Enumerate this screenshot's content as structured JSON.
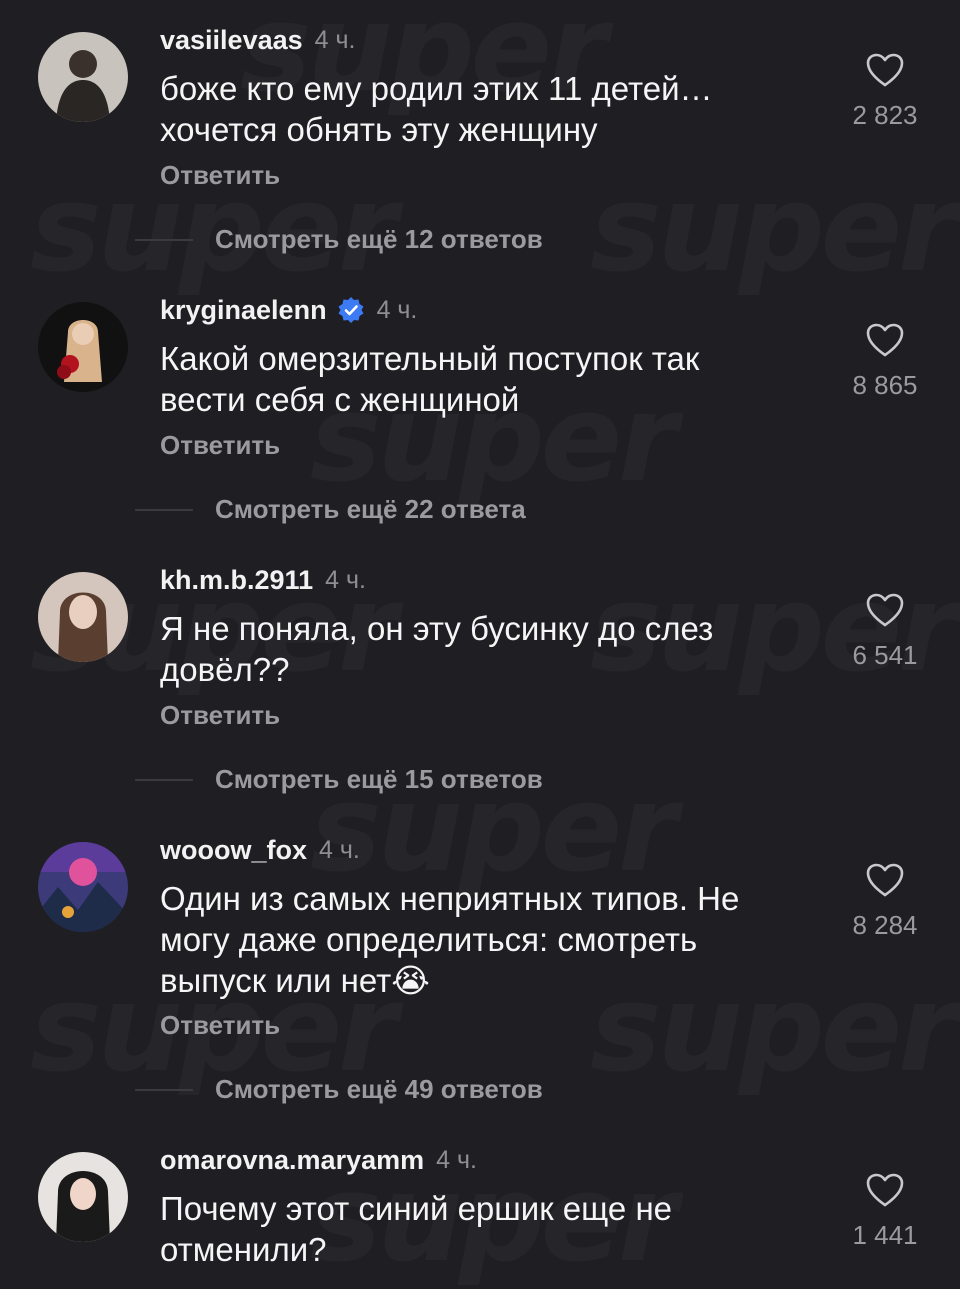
{
  "watermark": "super",
  "comments": [
    {
      "username": "vasiilevaas",
      "verified": false,
      "time": "4 ч.",
      "text_lines": [
        "боже кто ему родил этих 11 детей…",
        "хочется обнять эту женщину"
      ],
      "reply_label": "Ответить",
      "likes": "2 823",
      "more_replies": "Смотреть ещё 12 ответов",
      "avatar_colors": [
        "#c8c3bd",
        "#2a2624"
      ]
    },
    {
      "username": "kryginaelenn",
      "verified": true,
      "time": "4 ч.",
      "text_lines": [
        "Какой омерзительный поступок так",
        "вести себя с женщиной"
      ],
      "reply_label": "Ответить",
      "likes": "8 865",
      "more_replies": "Смотреть ещё 22 ответа",
      "avatar_colors": [
        "#111111",
        "#d9b38c"
      ]
    },
    {
      "username": "kh.m.b.2911",
      "verified": false,
      "time": "4 ч.",
      "text_lines": [
        "Я не поняла, он эту бусинку до слез",
        "довёл??"
      ],
      "reply_label": "Ответить",
      "likes": "6 541",
      "more_replies": "Смотреть ещё 15 ответов",
      "avatar_colors": [
        "#d4c6bd",
        "#5a3f30"
      ]
    },
    {
      "username": "wooow_fox",
      "verified": false,
      "time": "4 ч.",
      "text_lines": [
        "Один из самых неприятных типов. Не",
        "могу даже определиться: смотреть",
        "выпуск или нет😭"
      ],
      "reply_label": "Ответить",
      "likes": "8 284",
      "more_replies": "Смотреть ещё 49 ответов",
      "avatar_colors": [
        "#3d3a7a",
        "#e0529c"
      ]
    },
    {
      "username": "omarovna.maryamm",
      "verified": false,
      "time": "4 ч.",
      "text_lines": [
        "Почему этот синий ершик еще не",
        "отменили?"
      ],
      "reply_label": "",
      "likes": "1 441",
      "more_replies": "",
      "avatar_colors": [
        "#e6e3e0",
        "#1a1a1a"
      ]
    }
  ],
  "colors": {
    "background": "#1f1f23",
    "primary_text": "#f5f5f5",
    "secondary_text": "#9a9a9f",
    "verified_blue": "#3d7bf5"
  },
  "icons": {
    "like": "heart-outline-icon",
    "verified": "verified-badge-icon"
  }
}
